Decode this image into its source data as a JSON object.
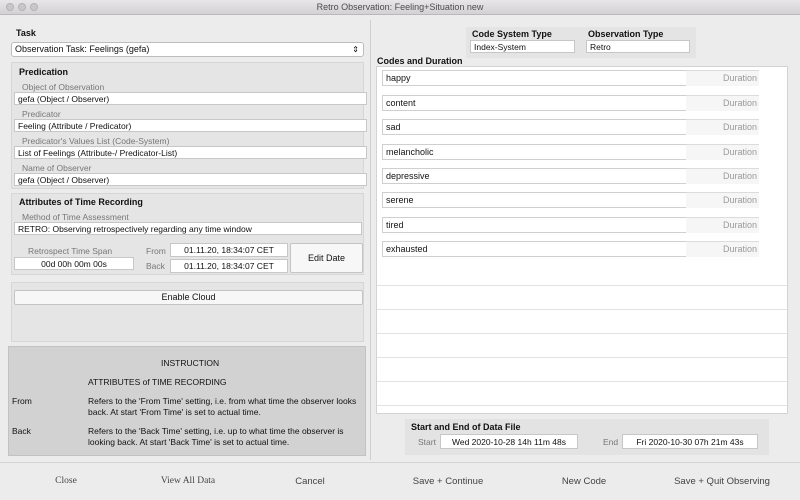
{
  "window": {
    "title": "Retro Observation: Feeling+Situation new"
  },
  "task": {
    "heading": "Task",
    "selected": "Observation Task: Feelings (gefa)"
  },
  "predication": {
    "heading": "Predication",
    "object_label": "Object of Observation",
    "object_value": "gefa (Object / Observer)",
    "predicator_label": "Predicator",
    "predicator_value": "Feeling (Attribute / Predicator)",
    "values_list_label": "Predicator's Values List (Code-System)",
    "values_list_value": "List of Feelings (Attribute-/ Predicator-List)",
    "observer_label": "Name of Observer",
    "observer_value": "gefa (Object / Observer)"
  },
  "time_recording": {
    "heading": "Attributes of Time Recording",
    "method_label": "Method of Time Assessment",
    "method_value": "RETRO: Observing retrospectively regarding any time window",
    "span_label": "Retrospect Time Span",
    "span_value": "00d 00h 00m 00s",
    "from_label": "From",
    "from_value": "01.11.20, 18:34:07 CET",
    "back_label": "Back",
    "back_value": "01.11.20, 18:34:07 CET",
    "edit_date_label": "Edit Date"
  },
  "cloud": {
    "enable_label": "Enable Cloud"
  },
  "instruction": {
    "title": "INSTRUCTION",
    "subtitle": "ATTRIBUTES of TIME RECORDING",
    "items": [
      {
        "term": "From",
        "text": "Refers to the 'From Time' setting, i.e. from what time the observer looks back. At start 'From Time' is set to actual time."
      },
      {
        "term": "Back",
        "text": "Refers to the 'Back Time' setting, i.e. up to what time the observer is looking back. At start 'Back Time' is set to actual time."
      }
    ]
  },
  "right": {
    "code_system_type_label": "Code System Type",
    "code_system_type_value": "Index-System",
    "observation_type_label": "Observation Type",
    "observation_type_value": "Retro",
    "codes_heading": "Codes and Duration",
    "codes": [
      {
        "name": "happy",
        "duration": "Duration"
      },
      {
        "name": "content",
        "duration": "Duration"
      },
      {
        "name": "sad",
        "duration": "Duration"
      },
      {
        "name": "melancholic",
        "duration": "Duration"
      },
      {
        "name": "depressive",
        "duration": "Duration"
      },
      {
        "name": "serene",
        "duration": "Duration"
      },
      {
        "name": "tired",
        "duration": "Duration"
      },
      {
        "name": "exhausted",
        "duration": "Duration"
      }
    ],
    "data_file_heading": "Start and End of Data File",
    "start_label": "Start",
    "start_value": "Wed 2020-10-28  14h 11m 48s",
    "end_label": "End",
    "end_value": "Fri 2020-10-30  07h 21m 43s"
  },
  "footer": {
    "close": "Close",
    "view_all_data": "View All Data",
    "cancel": "Cancel",
    "save_continue": "Save + Continue",
    "new_code": "New Code",
    "save_quit": "Save + Quit Observing"
  },
  "colors": {
    "window_bg": "#ececec",
    "panel_bg": "#e5e5e5",
    "instruction_bg": "#d2d2d2",
    "field_bg": "#ffffff"
  }
}
